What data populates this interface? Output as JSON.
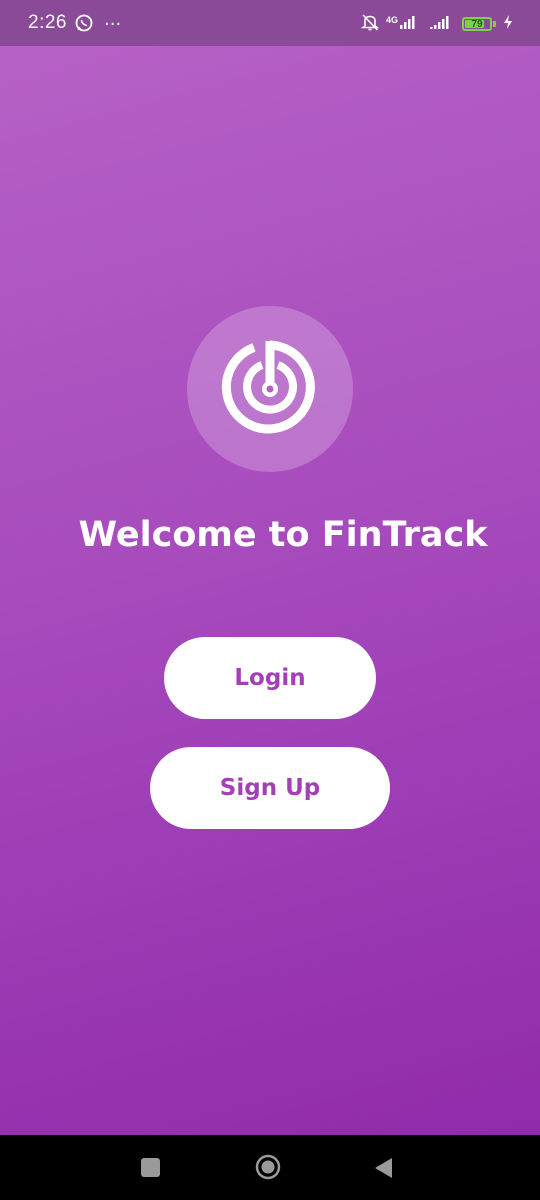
{
  "status_bar": {
    "time": "2:26",
    "more_dots": "···",
    "network": "4G",
    "battery_level": 79,
    "battery_label": "79",
    "icons": [
      "whatsapp-icon",
      "more-icon",
      "bell-muted-icon",
      "signal-icon",
      "signal-icon",
      "battery-icon",
      "charging-icon"
    ]
  },
  "app": {
    "logo_icon": "fintrack-logo-icon",
    "welcome_text": "Welcome to FinTrack",
    "login_label": "Login",
    "signup_label": "Sign Up"
  },
  "nav_bar": {
    "icons": [
      "recents-square-icon",
      "home-circle-icon",
      "back-triangle-icon"
    ]
  },
  "colors": {
    "gradient_top": "#b862c6",
    "gradient_bottom": "#8f27a9",
    "status_bar": "#8a4a97",
    "button_text": "#a340b5",
    "button_bg": "#ffffff",
    "battery": "#7ad14b"
  }
}
